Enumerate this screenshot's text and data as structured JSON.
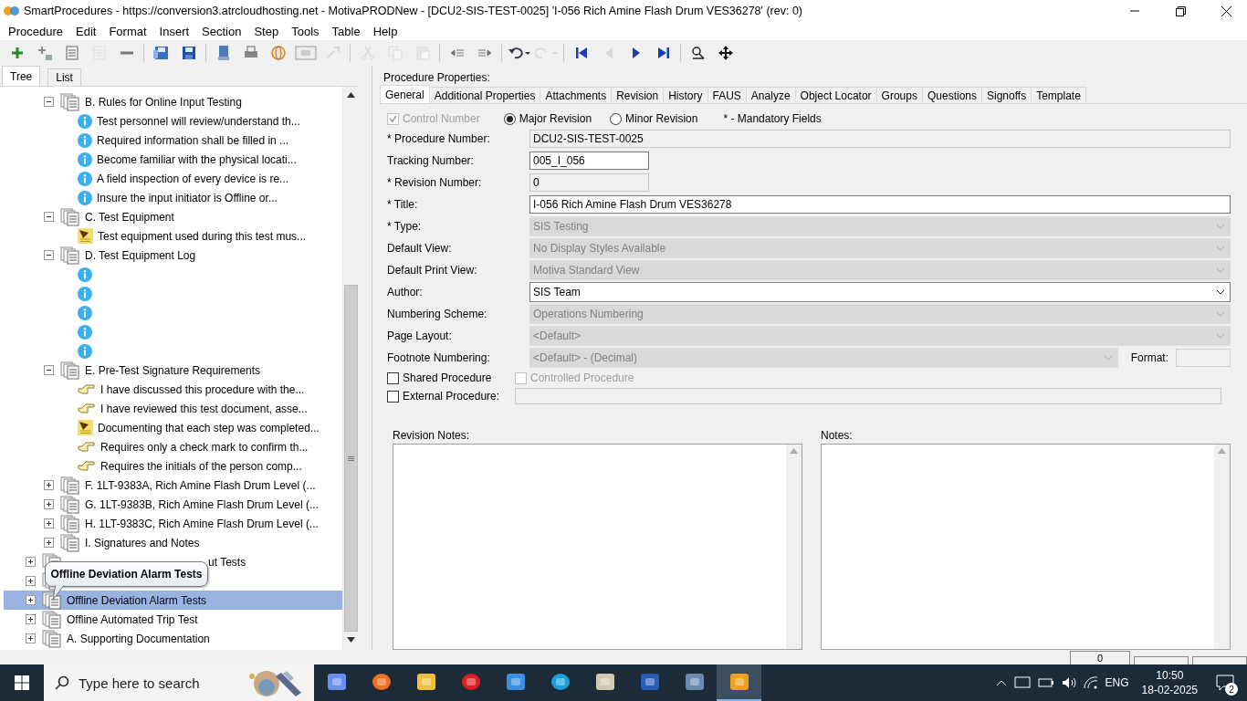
{
  "window": {
    "title": "SmartProcedures - https://conversion3.atrcloudhosting.net - MotivaPRODNew - [DCU2-SIS-TEST-0025] 'I-056 Rich Amine Flash Drum VES36278' (rev: 0)"
  },
  "menu": [
    "Procedure",
    "Edit",
    "Format",
    "Insert",
    "Section",
    "Step",
    "Tools",
    "Table",
    "Help"
  ],
  "toolbar": [
    {
      "buttons": [
        {
          "kind": "add",
          "disabled": false
        },
        {
          "kind": "add-sub",
          "disabled": false
        },
        {
          "kind": "list",
          "disabled": false
        },
        {
          "kind": "list",
          "disabled": true
        },
        {
          "kind": "minus",
          "disabled": false
        }
      ]
    },
    {
      "buttons": [
        {
          "kind": "save-as",
          "disabled": false
        },
        {
          "kind": "save",
          "disabled": false
        }
      ]
    },
    {
      "buttons": [
        {
          "kind": "computer",
          "disabled": false
        },
        {
          "kind": "print",
          "disabled": false
        },
        {
          "kind": "globe",
          "disabled": false
        },
        {
          "kind": "frame",
          "disabled": false
        },
        {
          "kind": "export",
          "disabled": true
        }
      ]
    },
    {
      "buttons": [
        {
          "kind": "cut",
          "disabled": true
        },
        {
          "kind": "copy",
          "disabled": true
        },
        {
          "kind": "paste",
          "disabled": true
        }
      ]
    },
    {
      "buttons": [
        {
          "kind": "outdent",
          "disabled": false
        },
        {
          "kind": "indent",
          "disabled": false
        }
      ]
    },
    {
      "buttons": [
        {
          "kind": "undo",
          "disabled": false
        },
        {
          "kind": "redo",
          "disabled": true
        }
      ]
    },
    {
      "buttons": [
        {
          "kind": "first",
          "disabled": false
        },
        {
          "kind": "prev",
          "disabled": true
        },
        {
          "kind": "next",
          "disabled": false
        },
        {
          "kind": "last",
          "disabled": false
        }
      ]
    },
    {
      "buttons": [
        {
          "kind": "find",
          "disabled": false
        },
        {
          "kind": "move",
          "disabled": false
        }
      ]
    }
  ],
  "tree": {
    "tabs": [
      {
        "label": "Tree",
        "selected": true
      },
      {
        "label": "List",
        "selected": false
      }
    ],
    "sections": [
      {
        "label": "B. Rules for Online Input Testing",
        "expanded": true,
        "selected": false,
        "children": [
          {
            "kind": "info",
            "label": "Test personnel will review/understand th...",
            "selected": false
          },
          {
            "kind": "info",
            "label": "Required information shall be filled in ...",
            "selected": false
          },
          {
            "kind": "info",
            "label": "Become familiar with the physical locati...",
            "selected": false
          },
          {
            "kind": "info",
            "label": "A field inspection of every device is re...",
            "selected": false
          },
          {
            "kind": "info",
            "label": "Insure the input initiator is Offline or...",
            "selected": false
          }
        ]
      },
      {
        "label": "C. Test Equipment",
        "expanded": true,
        "selected": false,
        "children": [
          {
            "kind": "note",
            "label": "Test equipment used during this test mus...",
            "selected": false
          }
        ]
      },
      {
        "label": "D. Test Equipment Log",
        "expanded": true,
        "selected": false,
        "children": [
          {
            "kind": "info",
            "selected": false
          },
          {
            "kind": "info",
            "selected": false
          },
          {
            "kind": "info",
            "selected": false
          },
          {
            "kind": "info",
            "selected": false
          },
          {
            "kind": "info",
            "selected": false
          }
        ]
      },
      {
        "label": "E. Pre-Test Signature Requirements",
        "expanded": true,
        "selected": false,
        "children": [
          {
            "kind": "hand",
            "label": "I have discussed this procedure with the...",
            "selected": false
          },
          {
            "kind": "hand",
            "label": "I have reviewed this test document, asse...",
            "selected": false
          },
          {
            "kind": "note",
            "label": "Documenting that each step was completed...",
            "selected": false
          },
          {
            "kind": "hand",
            "label": "Requires only a check mark to confirm th...",
            "selected": false
          },
          {
            "kind": "hand",
            "label": "Requires the initials of the person comp...",
            "selected": false
          }
        ]
      },
      {
        "label": "F. 1LT-9383A, Rich Amine Flash Drum Level (...",
        "expanded": false,
        "selected": false
      },
      {
        "label": "G. 1LT-9383B, Rich Amine Flash Drum Level (...",
        "expanded": false,
        "selected": false
      },
      {
        "label": "H. 1LT-9383C, Rich Amine Flash Drum Level (...",
        "expanded": false,
        "selected": false
      },
      {
        "label": "I. Signatures and Notes",
        "expanded": false,
        "selected": false
      }
    ],
    "items": [
      {
        "kind": "covered",
        "label": "ut Tests",
        "expanded": false,
        "selected": false
      },
      {
        "expanded": false
      },
      {
        "kind": "plain",
        "label": "Offline Deviation Alarm Tests",
        "expanded": false,
        "selected": true
      },
      {
        "kind": "plain",
        "label": "Offline Automated Trip Test",
        "expanded": false,
        "selected": false
      },
      {
        "kind": "plain",
        "label": "A. Supporting Documentation",
        "expanded": false,
        "selected": false
      }
    ],
    "tooltip": "Offline Deviation Alarm Tests"
  },
  "properties": {
    "heading": "Procedure Properties:",
    "tabs": [
      {
        "label": "General",
        "selected": true
      },
      {
        "label": "Additional Properties",
        "selected": false
      },
      {
        "label": "Attachments",
        "selected": false
      },
      {
        "label": "Revision",
        "selected": false
      },
      {
        "label": "History",
        "selected": false
      },
      {
        "label": "FAUS",
        "selected": false
      },
      {
        "label": "Analyze",
        "selected": false
      },
      {
        "label": "Object Locator",
        "selected": false
      },
      {
        "label": "Groups",
        "selected": false
      },
      {
        "label": "Questions",
        "selected": false
      },
      {
        "label": "Signoffs",
        "selected": false
      },
      {
        "label": "Template",
        "selected": false
      }
    ],
    "control_number": {
      "label": "Control Number",
      "checked": true,
      "disabled": true
    },
    "revision_type": [
      {
        "label": "Major Revision",
        "selected": true
      },
      {
        "label": "Minor Revision",
        "selected": false
      }
    ],
    "mandatory_note": "* - Mandatory Fields",
    "fields": [
      {
        "kind": "text",
        "label": "* Procedure Number:",
        "value": "DCU2-SIS-TEST-0025",
        "disabled": true,
        "short": false
      },
      {
        "kind": "text",
        "label": "Tracking Number:",
        "value": "005_I_056",
        "disabled": false,
        "short": true
      },
      {
        "kind": "text",
        "label": "* Revision Number:",
        "value": "0",
        "disabled": true,
        "short": true
      },
      {
        "kind": "text",
        "label": "* Title:",
        "value": "I-056 Rich Amine Flash Drum VES36278",
        "disabled": false,
        "short": false
      },
      {
        "kind": "select",
        "label": "* Type:",
        "value": "SIS Testing",
        "disabled": true
      },
      {
        "kind": "select",
        "label": "Default View:",
        "value": "No Display Styles Available",
        "disabled": true
      },
      {
        "kind": "select",
        "label": "Default Print View:",
        "value": "Motiva Standard View",
        "disabled": true
      },
      {
        "kind": "select",
        "label": "Author:",
        "value": "SIS Team",
        "disabled": false
      },
      {
        "kind": "select",
        "label": "Numbering Scheme:",
        "value": "Operations Numbering",
        "disabled": true
      },
      {
        "kind": "select",
        "label": "Page Layout:",
        "value": "<Default>",
        "disabled": true
      },
      {
        "kind": "format",
        "label": "Footnote Numbering:",
        "value": "<Default> - (Decimal)",
        "disabled": true,
        "format_label": "Format:"
      }
    ],
    "checkboxes": [
      {
        "label": "Shared Procedure",
        "checked": false,
        "disabled": false
      },
      {
        "label": "Controlled Procedure",
        "checked": false,
        "disabled": true
      }
    ],
    "external": {
      "label": "External Procedure:",
      "checked": false
    },
    "notes": [
      {
        "title": "Revision Notes:"
      },
      {
        "title": "Notes:"
      }
    ]
  },
  "status_bar": [
    "0"
  ],
  "taskbar": {
    "search_placeholder": "Type here to search",
    "apps": [
      {
        "kind": "copilot",
        "selected": false
      },
      {
        "kind": "firefox",
        "selected": false
      },
      {
        "kind": "folder",
        "selected": false
      },
      {
        "kind": "opera",
        "selected": false
      },
      {
        "kind": "mail",
        "selected": false
      },
      {
        "kind": "edge",
        "selected": false
      },
      {
        "kind": "viewer",
        "selected": false
      },
      {
        "kind": "word",
        "selected": false
      },
      {
        "kind": "editor",
        "selected": false
      },
      {
        "kind": "smart",
        "selected": true
      }
    ],
    "language": "ENG",
    "time": "10:50",
    "date": "18-02-2025",
    "notifications": "2"
  }
}
